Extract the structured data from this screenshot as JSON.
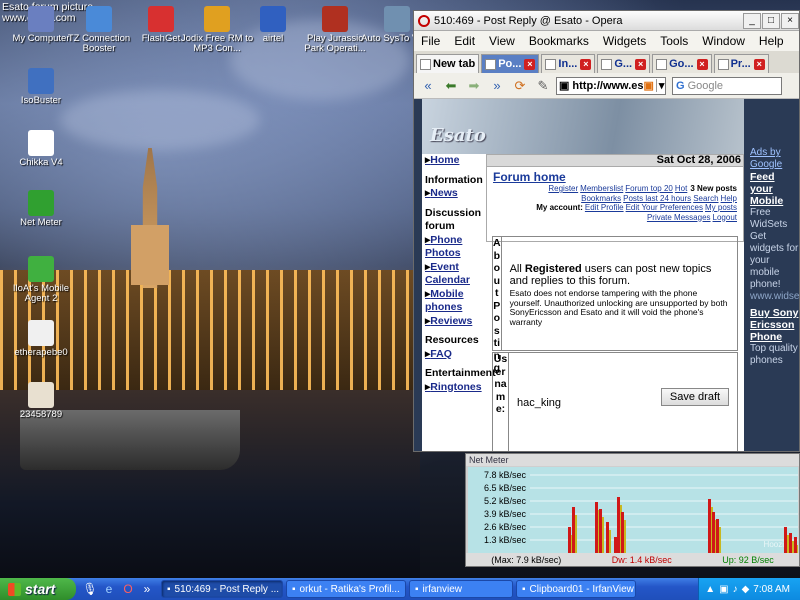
{
  "desktop": {
    "top_text": [
      "Esato forum picture",
      "www.esato.com"
    ],
    "icons": [
      {
        "label": "My Computer",
        "icon": "computer-icon",
        "color": "#6a7fc0"
      },
      {
        "label": "TZ Connection Booster",
        "icon": "booster-icon",
        "color": "#4a8ad8"
      },
      {
        "label": "FlashGet",
        "icon": "flashget-icon",
        "color": "#d83030"
      },
      {
        "label": "Jodix Free RM to MP3 Con...",
        "icon": "converter-icon",
        "color": "#e0a020"
      },
      {
        "label": "airtel",
        "icon": "airtel-icon",
        "color": "#3060c0"
      },
      {
        "label": "Play Jurassic Park Operati...",
        "icon": "jurassic-park-icon",
        "color": "#b03020"
      },
      {
        "label": "Auto SysTo Vista",
        "icon": "systool-icon",
        "color": "#7090b0"
      },
      {
        "label": "IsoBuster",
        "icon": "isobuster-icon",
        "color": "#4070c0"
      },
      {
        "label": "Chikka V4",
        "icon": "chikka-icon",
        "color": "#ffffff"
      },
      {
        "label": "Net Meter",
        "icon": "netmeter-icon",
        "color": "#30a030"
      },
      {
        "label": "IloAt's Mobile Agent 2",
        "icon": "mobile-agent-icon",
        "color": "#40b040"
      },
      {
        "label": "etherapebe0",
        "icon": "document-icon",
        "color": "#f0f0f0"
      },
      {
        "label": "23458789",
        "icon": "image-file-icon",
        "color": "#e8e0d0"
      }
    ]
  },
  "browser": {
    "title": "510:469 - Post Reply @ Esato - Opera",
    "window_buttons": [
      "_",
      "□",
      "×"
    ],
    "menu": [
      "File",
      "Edit",
      "View",
      "Bookmarks",
      "Widgets",
      "Tools",
      "Window",
      "Help"
    ],
    "tabs": [
      {
        "label": "New tab",
        "state": "new"
      },
      {
        "label": "Po...",
        "state": "active"
      },
      {
        "label": "In...",
        "state": "normal"
      },
      {
        "label": "G...",
        "state": "normal"
      },
      {
        "label": "Go...",
        "state": "normal"
      },
      {
        "label": "Pr...",
        "state": "normal"
      }
    ],
    "address": "http://www.es",
    "search_placeholder": "Google"
  },
  "page": {
    "logo": "Esato",
    "date": "Sat Oct 28, 2006",
    "nav": [
      {
        "type": "link",
        "text": "Home"
      },
      {
        "type": "heading",
        "text": "Information"
      },
      {
        "type": "link",
        "text": "News"
      },
      {
        "type": "heading",
        "text": "Discussion forum"
      },
      {
        "type": "link",
        "text": "Phone Photos"
      },
      {
        "type": "link",
        "text": "Event Calendar"
      },
      {
        "type": "link",
        "text": "Mobile phones"
      },
      {
        "type": "link",
        "text": "Reviews"
      },
      {
        "type": "heading",
        "text": "Resources"
      },
      {
        "type": "link",
        "text": "FAQ"
      },
      {
        "type": "heading",
        "text": "Entertainment"
      },
      {
        "type": "link",
        "text": "Ringtones"
      }
    ],
    "forum_home": "Forum home",
    "links_row1": [
      "Register",
      "Memberslist",
      "Forum top 20",
      "Hot"
    ],
    "new_posts": "3 New posts",
    "links_row2": [
      "Bookmarks",
      "Posts last 24 hours",
      "Search",
      "Help"
    ],
    "my_account_label": "My account:",
    "links_row3": [
      "Edit Profile",
      "Edit Your Preferences",
      "My posts"
    ],
    "links_row4": [
      "Private Messages",
      "Logout"
    ],
    "about_label": "About Posting",
    "about_text_pre": "All ",
    "about_text_bold": "Registered",
    "about_text_post": " users can post new topics and replies to this forum.",
    "about_small": "Esato does not endorse tampering with the phone yourself. Unauthorized unlocking are unsupported by both SonyEricsson and Esato and it will void the phone's warranty",
    "username_label": "Username:",
    "username_value": "hac_king",
    "save_draft": "Save draft",
    "sidebar_ads": "Ads by Google",
    "ad1_title": "Feed your Mobile",
    "ad1_text": "Free WidSets Get widgets for your mobile phone!",
    "ad1_url": "www.widsets.com",
    "ad2_title": "Buy Sony Ericsson Phone",
    "ad2_text": "Top quality phones"
  },
  "netmeter": {
    "title": "Net Meter",
    "y_labels": [
      "7.8 kB/sec",
      "6.5 kB/sec",
      "5.2 kB/sec",
      "3.9 kB/sec",
      "2.6 kB/sec",
      "1.3 kB/sec"
    ],
    "max": "(Max: 7.9 kB/sec)",
    "down": "Dw: 1.4 kB/sec",
    "up": "Up: 92 B/sec",
    "watermark": "Hoozi"
  },
  "taskbar": {
    "start": "start",
    "overflow": "»",
    "tasks": [
      {
        "label": "510:469 - Post Reply ...",
        "active": true
      },
      {
        "label": "orkut - Ratika's Profil...",
        "active": false
      },
      {
        "label": "irfanview",
        "active": false
      },
      {
        "label": "Clipboard01 - IrfanView",
        "active": false
      }
    ],
    "time": "7:08 AM"
  }
}
